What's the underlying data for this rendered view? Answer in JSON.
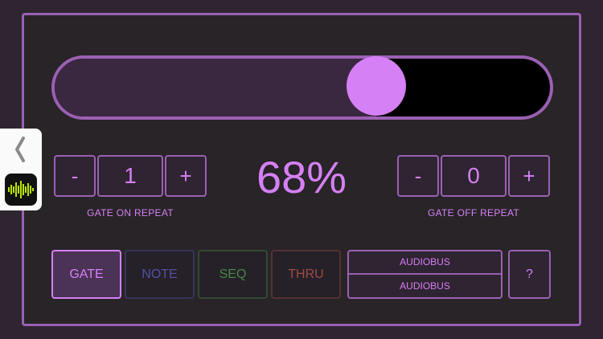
{
  "slider": {
    "value_percent": 68
  },
  "gate_on": {
    "minus": "-",
    "value": "1",
    "plus": "+",
    "label": "GATE ON REPEAT"
  },
  "gate_off": {
    "minus": "-",
    "value": "0",
    "plus": "+",
    "label": "GATE OFF REPEAT"
  },
  "percent_display": "68%",
  "modes": [
    {
      "label": "GATE",
      "color": "#d680f5",
      "active": true
    },
    {
      "label": "NOTE",
      "color": "#5a5ac0",
      "active": false
    },
    {
      "label": "SEQ",
      "color": "#4e9a4e",
      "active": false
    },
    {
      "label": "THRU",
      "color": "#b0534a",
      "active": false
    }
  ],
  "audiobus": {
    "top": "AUDIOBUS",
    "bottom": "AUDIOBUS"
  },
  "help_label": "?",
  "colors": {
    "accent": "#d680f5",
    "border": "#9b60b4",
    "background": "#2e2530"
  },
  "sidebar": {
    "back_icon": "chevron-left-icon",
    "app_icon": "audiobus-waveform-icon"
  }
}
